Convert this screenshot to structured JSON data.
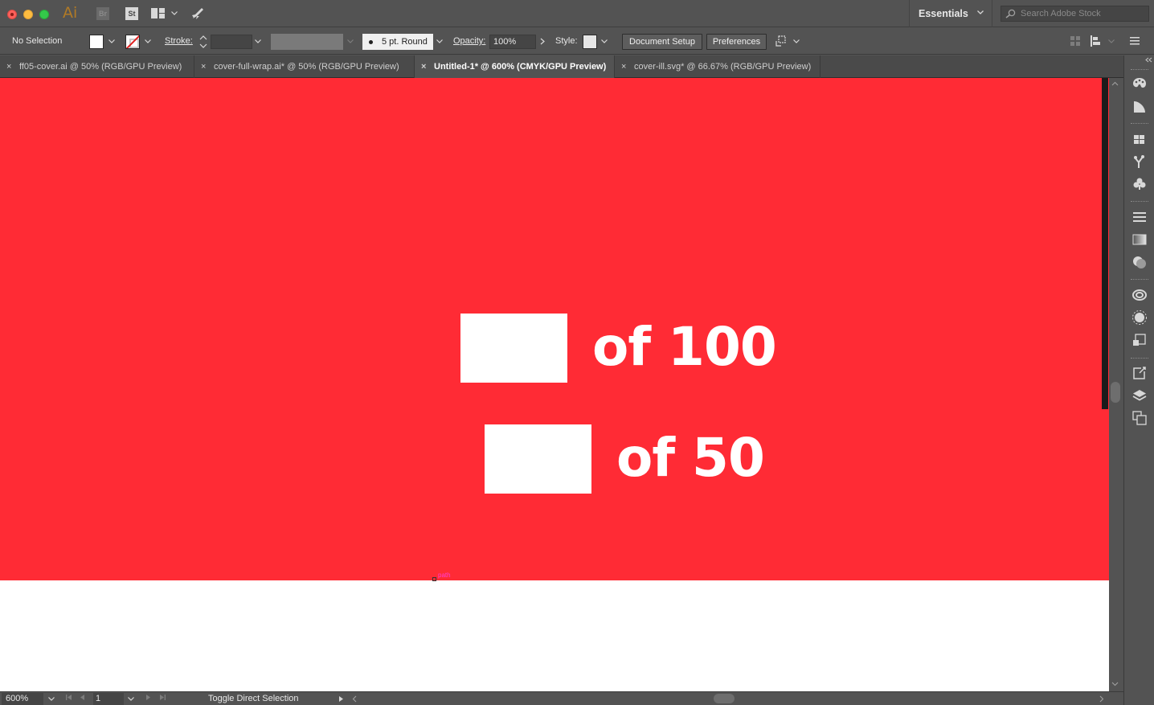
{
  "titlebar": {
    "app_logo": "Ai",
    "bridge_label": "Br",
    "stock_label": "St",
    "workspace": "Essentials",
    "search_placeholder": "Search Adobe Stock"
  },
  "control": {
    "selection": "No Selection",
    "stroke_label": "Stroke:",
    "stroke_weight": "",
    "brush": "5 pt. Round",
    "opacity_label": "Opacity:",
    "opacity_value": "100%",
    "style_label": "Style:",
    "document_setup": "Document Setup",
    "preferences": "Preferences"
  },
  "tabs": [
    {
      "label": "ff05-cover.ai @ 50% (RGB/GPU Preview)",
      "active": false
    },
    {
      "label": "cover-full-wrap.ai* @ 50% (RGB/GPU Preview)",
      "active": false
    },
    {
      "label": "Untitled-1* @ 600% (CMYK/GPU Preview)",
      "active": true
    },
    {
      "label": "cover-ill.svg* @ 66.67% (RGB/GPU Preview)",
      "active": false
    }
  ],
  "artwork": {
    "background_color": "#ff2b35",
    "counter_1": "of 100",
    "counter_2": "of 50",
    "smart_guide": "path"
  },
  "status": {
    "zoom": "600%",
    "page": "1",
    "tool_hint": "Toggle Direct Selection"
  },
  "icons": {
    "close_tab": "×"
  }
}
